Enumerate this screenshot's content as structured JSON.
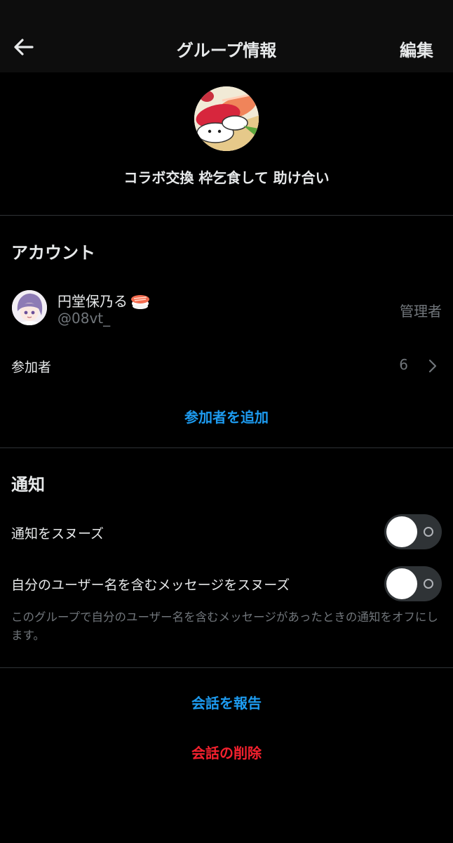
{
  "header": {
    "title": "グループ情報",
    "edit_label": "編集"
  },
  "group": {
    "name": "コラボ交換 枠乞食して 助け合い",
    "avatar_icon": "sushi-group-avatar"
  },
  "account_section": {
    "title": "アカウント",
    "member": {
      "name": "円堂保乃る",
      "emoji_icon": "sushi-icon",
      "handle": "@08vt_",
      "role": "管理者"
    },
    "participants_label": "参加者",
    "participants_count": "6",
    "add_participants_label": "参加者を追加"
  },
  "notification_section": {
    "title": "通知",
    "snooze_label": "通知をスヌーズ",
    "snooze_on": false,
    "mention_snooze_label": "自分のユーザー名を含むメッセージをスヌーズ",
    "mention_snooze_on": false,
    "hint": "このグループで自分のユーザー名を含むメッセージがあったときの通知をオフにします。"
  },
  "actions": {
    "report_label": "会話を報告",
    "delete_label": "会話の削除"
  },
  "colors": {
    "accent": "#1d9bf0",
    "danger": "#f4212e",
    "background": "#000000",
    "secondary_text": "#71767b"
  }
}
